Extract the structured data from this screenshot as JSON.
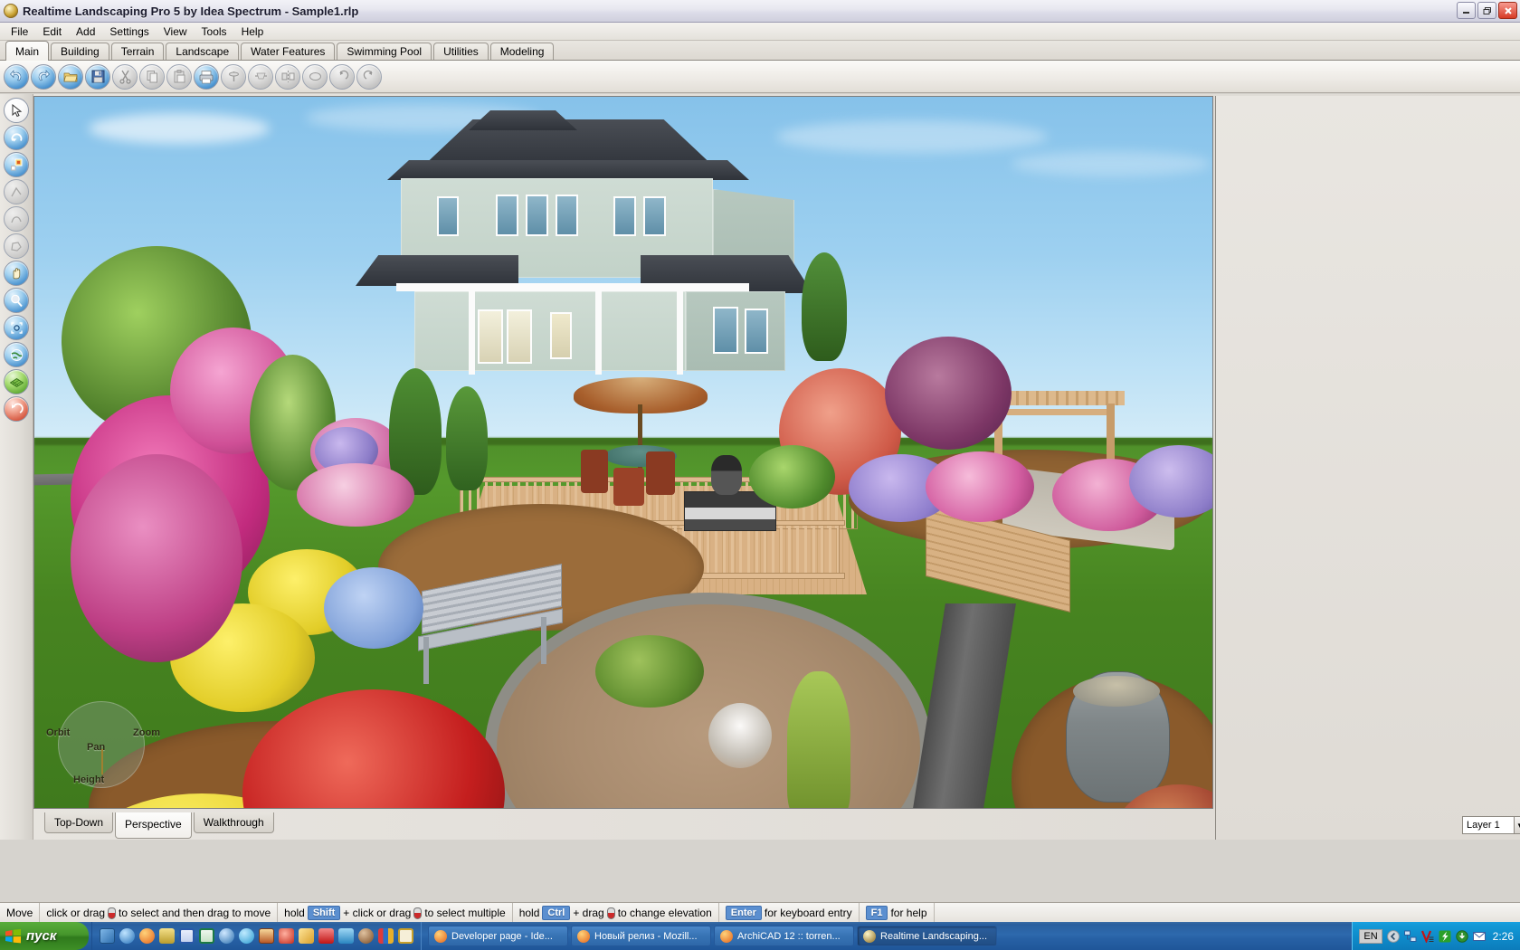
{
  "window": {
    "title": "Realtime Landscaping Pro 5 by Idea Spectrum - Sample1.rlp",
    "app_icon": "app-logo-icon",
    "minimize_label": "_",
    "maximize_label": "❐",
    "close_label": "✕"
  },
  "menu": {
    "items": [
      {
        "label": "File"
      },
      {
        "label": "Edit"
      },
      {
        "label": "Add"
      },
      {
        "label": "Settings"
      },
      {
        "label": "View"
      },
      {
        "label": "Tools"
      },
      {
        "label": "Help"
      }
    ]
  },
  "category_tabs": {
    "active": "Main",
    "items": [
      {
        "label": "Main"
      },
      {
        "label": "Building"
      },
      {
        "label": "Terrain"
      },
      {
        "label": "Landscape"
      },
      {
        "label": "Water Features"
      },
      {
        "label": "Swimming Pool"
      },
      {
        "label": "Utilities"
      },
      {
        "label": "Modeling"
      }
    ]
  },
  "toolbar": {
    "buttons": [
      {
        "name": "undo-icon",
        "state": "enabled",
        "tone": "blue"
      },
      {
        "name": "redo-icon",
        "state": "enabled",
        "tone": "blue"
      },
      {
        "name": "open-folder-icon",
        "state": "enabled",
        "tone": "blue"
      },
      {
        "name": "save-icon",
        "state": "enabled",
        "tone": "blue"
      },
      {
        "name": "cut-icon",
        "state": "disabled",
        "tone": "gray"
      },
      {
        "name": "copy-icon",
        "state": "disabled",
        "tone": "gray"
      },
      {
        "name": "paste-icon",
        "state": "disabled",
        "tone": "gray"
      },
      {
        "name": "print-icon",
        "state": "enabled",
        "tone": "blue"
      },
      {
        "name": "stake-icon",
        "state": "disabled",
        "tone": "gray"
      },
      {
        "name": "align-icon",
        "state": "disabled",
        "tone": "gray"
      },
      {
        "name": "mirror-icon",
        "state": "disabled",
        "tone": "gray"
      },
      {
        "name": "shape-icon",
        "state": "disabled",
        "tone": "gray"
      },
      {
        "name": "rotate-left-icon",
        "state": "disabled",
        "tone": "gray"
      },
      {
        "name": "rotate-right-icon",
        "state": "disabled",
        "tone": "gray"
      }
    ]
  },
  "tool_palette": {
    "buttons": [
      {
        "name": "select-arrow-tool",
        "tone": "white"
      },
      {
        "name": "rotate-tool",
        "tone": "blue"
      },
      {
        "name": "scale-tool",
        "tone": "blue"
      },
      {
        "name": "line-tool",
        "tone": "gray"
      },
      {
        "name": "curve-tool",
        "tone": "gray"
      },
      {
        "name": "polygon-tool",
        "tone": "gray"
      },
      {
        "name": "pan-hand-tool",
        "tone": "blue"
      },
      {
        "name": "zoom-tool",
        "tone": "blue"
      },
      {
        "name": "zoom-region-tool",
        "tone": "blue"
      },
      {
        "name": "orbit-globe-tool",
        "tone": "blue"
      },
      {
        "name": "terrain-grid-tool",
        "tone": "green"
      },
      {
        "name": "undo-view-tool",
        "tone": "red"
      }
    ]
  },
  "viewport": {
    "compass": {
      "orbit_label": "Orbit",
      "zoom_label": "Zoom",
      "pan_label": "Pan",
      "height_label": "Height"
    }
  },
  "view_tabs": {
    "active": "Perspective",
    "items": [
      {
        "label": "Top-Down"
      },
      {
        "label": "Perspective"
      },
      {
        "label": "Walkthrough"
      }
    ]
  },
  "layer_selector": {
    "value": "Layer 1",
    "arrow": "▼"
  },
  "status_bar": {
    "mode": "Move",
    "segments": [
      {
        "prefix": "click or drag",
        "icon": "mouse-icon",
        "key": "",
        "suffix": "to select and then drag to move"
      },
      {
        "prefix": "hold",
        "icon": "",
        "key": "Shift",
        "suffix": "+ click or drag",
        "icon2": "mouse-icon",
        "suffix2": "to select multiple"
      },
      {
        "prefix": "hold",
        "icon": "",
        "key": "Ctrl",
        "suffix": "+ drag",
        "icon2": "mouse-icon",
        "suffix2": "to change elevation"
      },
      {
        "prefix": "",
        "icon": "",
        "key": "Enter",
        "suffix": "for keyboard entry"
      },
      {
        "prefix": "",
        "icon": "",
        "key": "F1",
        "suffix": "for help"
      }
    ]
  },
  "taskbar": {
    "start_label": "пуск",
    "quick_launch": [
      {
        "name": "desktop-icon",
        "color": "#4a86c8"
      },
      {
        "name": "internet-explorer-icon",
        "color": "#2f7fc4"
      },
      {
        "name": "firefox-icon",
        "color": "#e8762a"
      },
      {
        "name": "notes-icon",
        "color": "#d8c24a"
      },
      {
        "name": "word-icon",
        "color": "#2a59a8"
      },
      {
        "name": "excel-icon",
        "color": "#1b7a43"
      },
      {
        "name": "media-player-icon",
        "color": "#3a86c8"
      },
      {
        "name": "winamp-icon",
        "color": "#3aa8d8"
      },
      {
        "name": "photo-icon",
        "color": "#c8522a"
      },
      {
        "name": "firework-icon",
        "color": "#d83a2a"
      },
      {
        "name": "paint-icon",
        "color": "#e8b83a"
      },
      {
        "name": "acrobat-icon",
        "color": "#d02020"
      },
      {
        "name": "usb-icon",
        "color": "#3a9ad8"
      },
      {
        "name": "nero-icon",
        "color": "#8a5a2a"
      },
      {
        "name": "ebay-icon",
        "color": "#e8a02a"
      },
      {
        "name": "clock-icon",
        "color": "#d8b84a"
      }
    ],
    "windows": [
      {
        "label": "Developer page - Ide...",
        "icon": "firefox-icon",
        "active": false
      },
      {
        "label": "Новый релиз - Mozill...",
        "icon": "firefox-icon",
        "active": false
      },
      {
        "label": "ArchiCAD 12 :: torren...",
        "icon": "firefox-icon",
        "active": false
      },
      {
        "label": "Realtime Landscaping...",
        "icon": "app-logo-icon",
        "active": true
      }
    ],
    "tray": {
      "language": "EN",
      "icons": [
        {
          "name": "show-hidden-icons-icon"
        },
        {
          "name": "network-icon"
        },
        {
          "name": "antivirus-icon"
        },
        {
          "name": "utorrent-icon"
        },
        {
          "name": "update-icon"
        },
        {
          "name": "mail-icon"
        }
      ],
      "clock": "2:26"
    }
  }
}
